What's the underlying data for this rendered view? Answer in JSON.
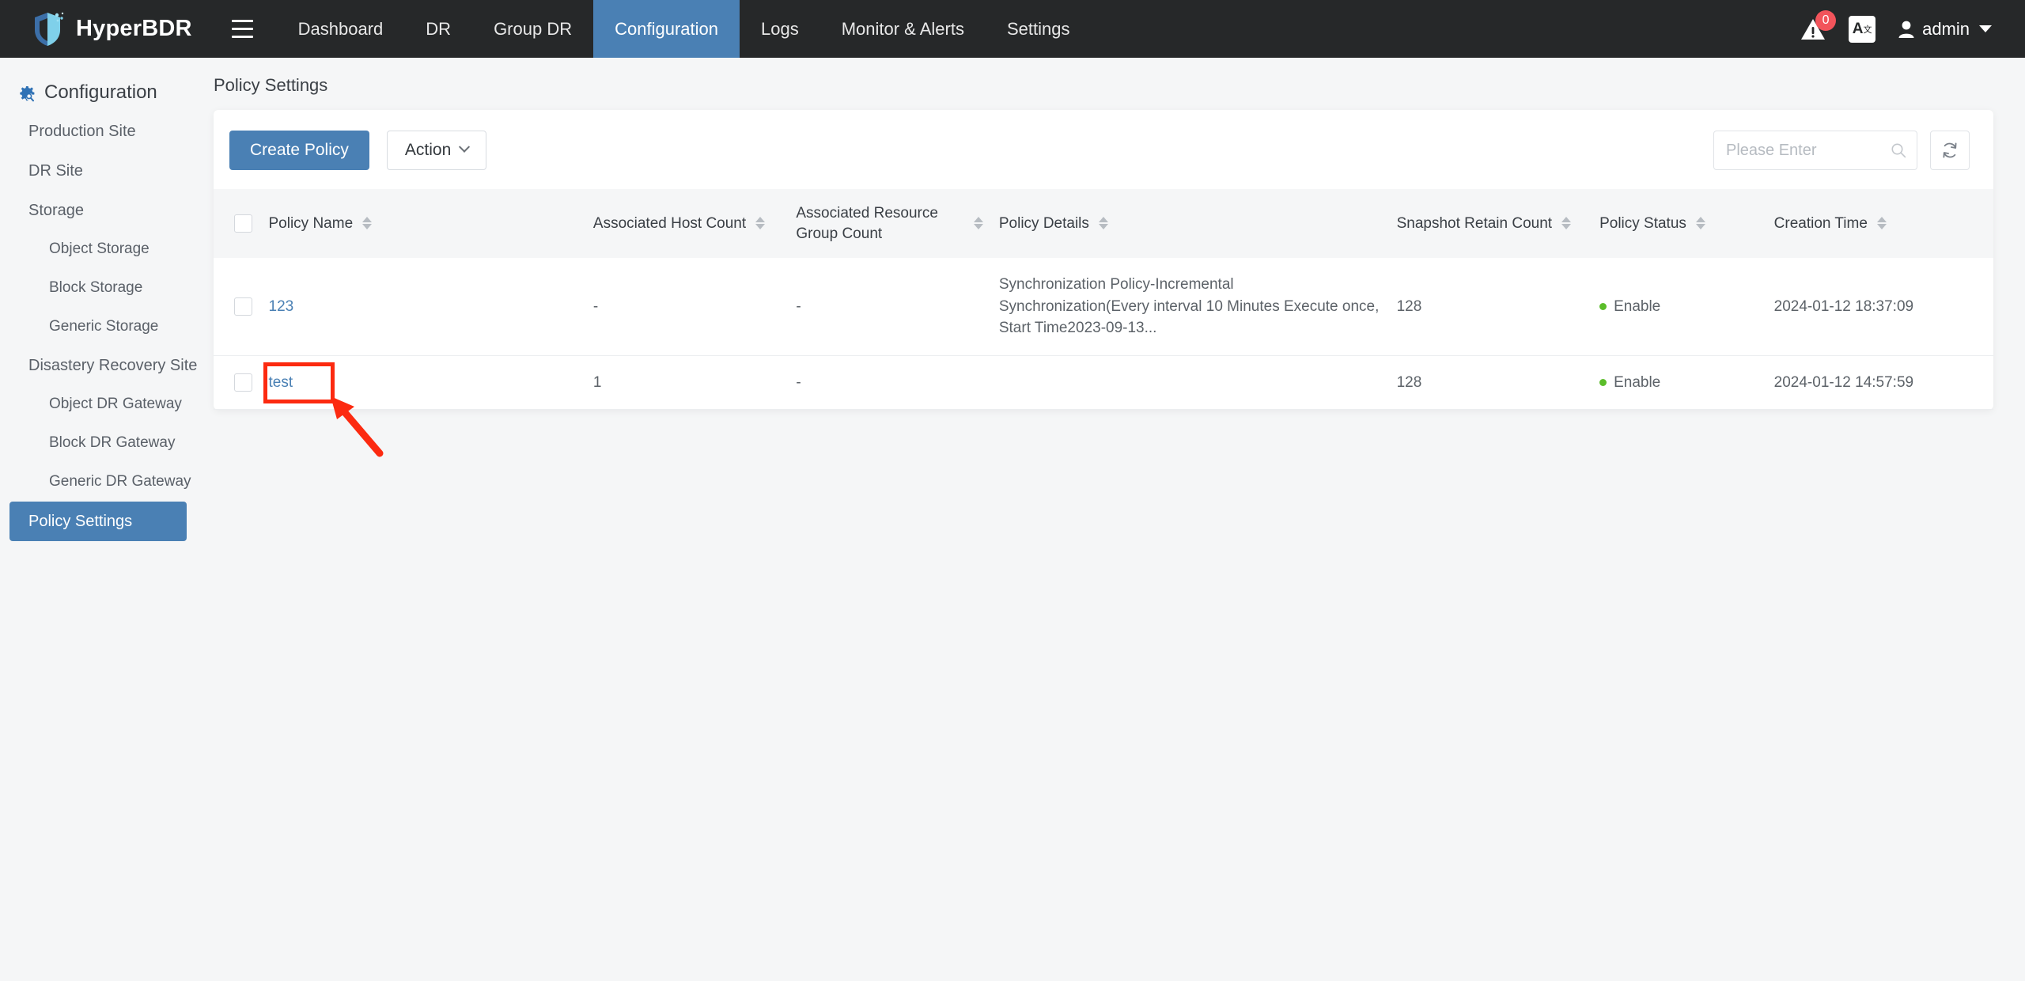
{
  "header": {
    "brand": "HyperBDR",
    "menu_icon": "hamburger-icon",
    "nav": [
      {
        "label": "Dashboard",
        "active": false
      },
      {
        "label": "DR",
        "active": false
      },
      {
        "label": "Group DR",
        "active": false
      },
      {
        "label": "Configuration",
        "active": true
      },
      {
        "label": "Logs",
        "active": false
      },
      {
        "label": "Monitor & Alerts",
        "active": false
      },
      {
        "label": "Settings",
        "active": false
      }
    ],
    "alert_badge": "0",
    "lang_label": "A",
    "lang_sup": "文",
    "user": "admin",
    "active_color": "#4a80b4",
    "bar_color": "#262829"
  },
  "sidebar": {
    "title": "Configuration",
    "items": [
      {
        "label": "Production Site",
        "level": 1,
        "active": false
      },
      {
        "label": "DR Site",
        "level": 1,
        "active": false
      },
      {
        "label": "Storage",
        "level": 1,
        "active": false
      },
      {
        "label": "Object Storage",
        "level": 2,
        "active": false
      },
      {
        "label": "Block Storage",
        "level": 2,
        "active": false
      },
      {
        "label": "Generic Storage",
        "level": 2,
        "active": false
      },
      {
        "label": "Disastery Recovery Site",
        "level": 1,
        "active": false
      },
      {
        "label": "Object DR Gateway",
        "level": 2,
        "active": false
      },
      {
        "label": "Block DR Gateway",
        "level": 2,
        "active": false
      },
      {
        "label": "Generic DR Gateway",
        "level": 2,
        "active": false
      },
      {
        "label": "Policy Settings",
        "level": 1,
        "active": true
      }
    ]
  },
  "page": {
    "title": "Policy Settings"
  },
  "toolbar": {
    "create_label": "Create Policy",
    "action_label": "Action",
    "search_placeholder": "Please Enter",
    "search_value": "",
    "refresh_title": "Refresh"
  },
  "table": {
    "columns": [
      {
        "key": "name",
        "label": "Policy Name",
        "sortable": true
      },
      {
        "key": "host",
        "label": "Associated Host Count",
        "sortable": true
      },
      {
        "key": "group",
        "label": "Associated Resource Group Count",
        "sortable": true
      },
      {
        "key": "detail",
        "label": "Policy Details",
        "sortable": true
      },
      {
        "key": "snap",
        "label": "Snapshot Retain Count",
        "sortable": true
      },
      {
        "key": "status",
        "label": "Policy Status",
        "sortable": true
      },
      {
        "key": "time",
        "label": "Creation Time",
        "sortable": true
      }
    ],
    "rows": [
      {
        "name": "123",
        "host": "-",
        "group": "-",
        "detail": "Synchronization Policy-Incremental Synchronization(Every interval 10 Minutes Execute once, Start Time2023-09-13...",
        "snap": "128",
        "status": "Enable",
        "time": "2024-01-12 18:37:09"
      },
      {
        "name": "test",
        "host": "1",
        "group": "-",
        "detail": "",
        "snap": "128",
        "status": "Enable",
        "time": "2024-01-12 14:57:59"
      }
    ],
    "status_color": "#5bbd2a",
    "link_color": "#4a80b4"
  },
  "annotation": {
    "highlight_target": "test",
    "color": "#fc2a10",
    "shape": "rectangle-with-arrow"
  }
}
